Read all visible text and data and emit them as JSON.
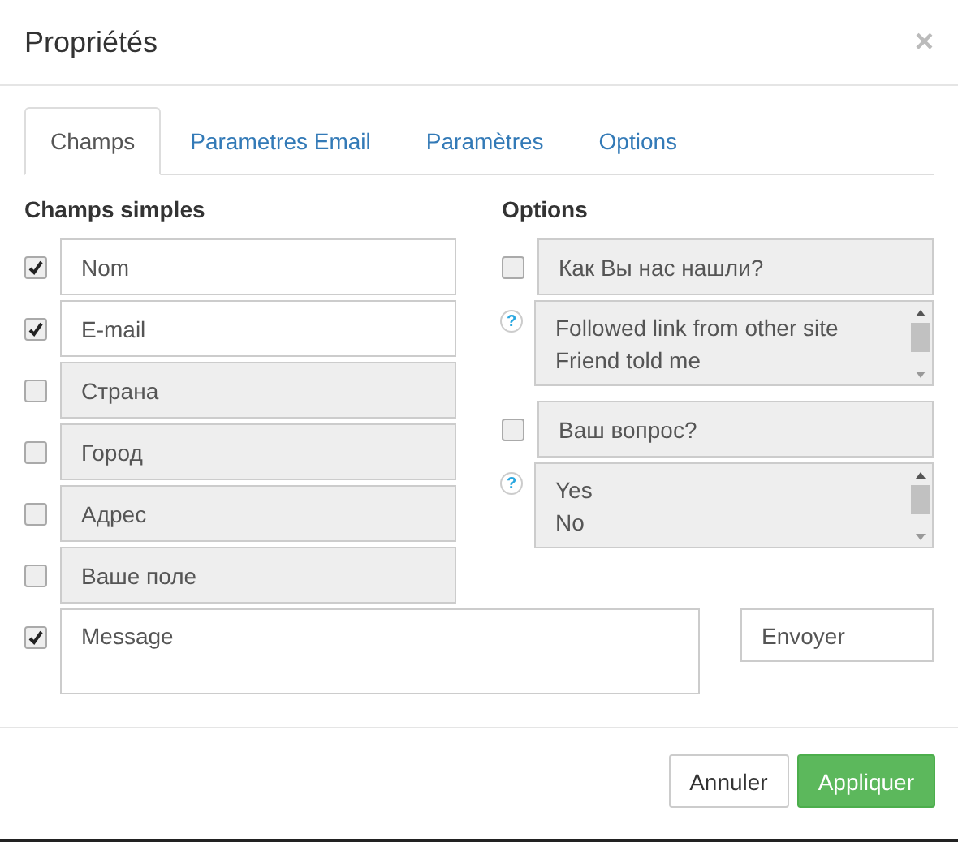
{
  "dialog": {
    "title": "Propriétés",
    "close": "×"
  },
  "tabs": [
    {
      "label": "Champs",
      "selected": true
    },
    {
      "label": "Parametres Email",
      "selected": false
    },
    {
      "label": "Paramètres",
      "selected": false
    },
    {
      "label": "Options",
      "selected": false
    }
  ],
  "simple_fields": {
    "heading": "Champs simples",
    "fields": [
      {
        "label": "Nom",
        "checked": true
      },
      {
        "label": "E-mail",
        "checked": true
      },
      {
        "label": "Страна",
        "checked": false
      },
      {
        "label": "Город",
        "checked": false
      },
      {
        "label": "Адрес",
        "checked": false
      },
      {
        "label": "Ваше поле",
        "checked": false
      }
    ]
  },
  "options": {
    "heading": "Options",
    "items": [
      {
        "kind": "question",
        "label": "Как Вы нас нашли?",
        "checked": false
      },
      {
        "kind": "list",
        "help": "?",
        "values": [
          "Followed link from other site",
          "Friend told me"
        ]
      },
      {
        "kind": "question",
        "label": "Ваш вопрос?",
        "checked": false
      },
      {
        "kind": "list",
        "help": "?",
        "values": [
          "Yes",
          "No"
        ]
      }
    ]
  },
  "message": {
    "label": "Message",
    "checked": true
  },
  "send_button": "Envoyer",
  "footer": {
    "buttons": [
      {
        "label": "Annuler",
        "kind": "default"
      },
      {
        "label": "Appliquer",
        "kind": "primary"
      }
    ]
  }
}
